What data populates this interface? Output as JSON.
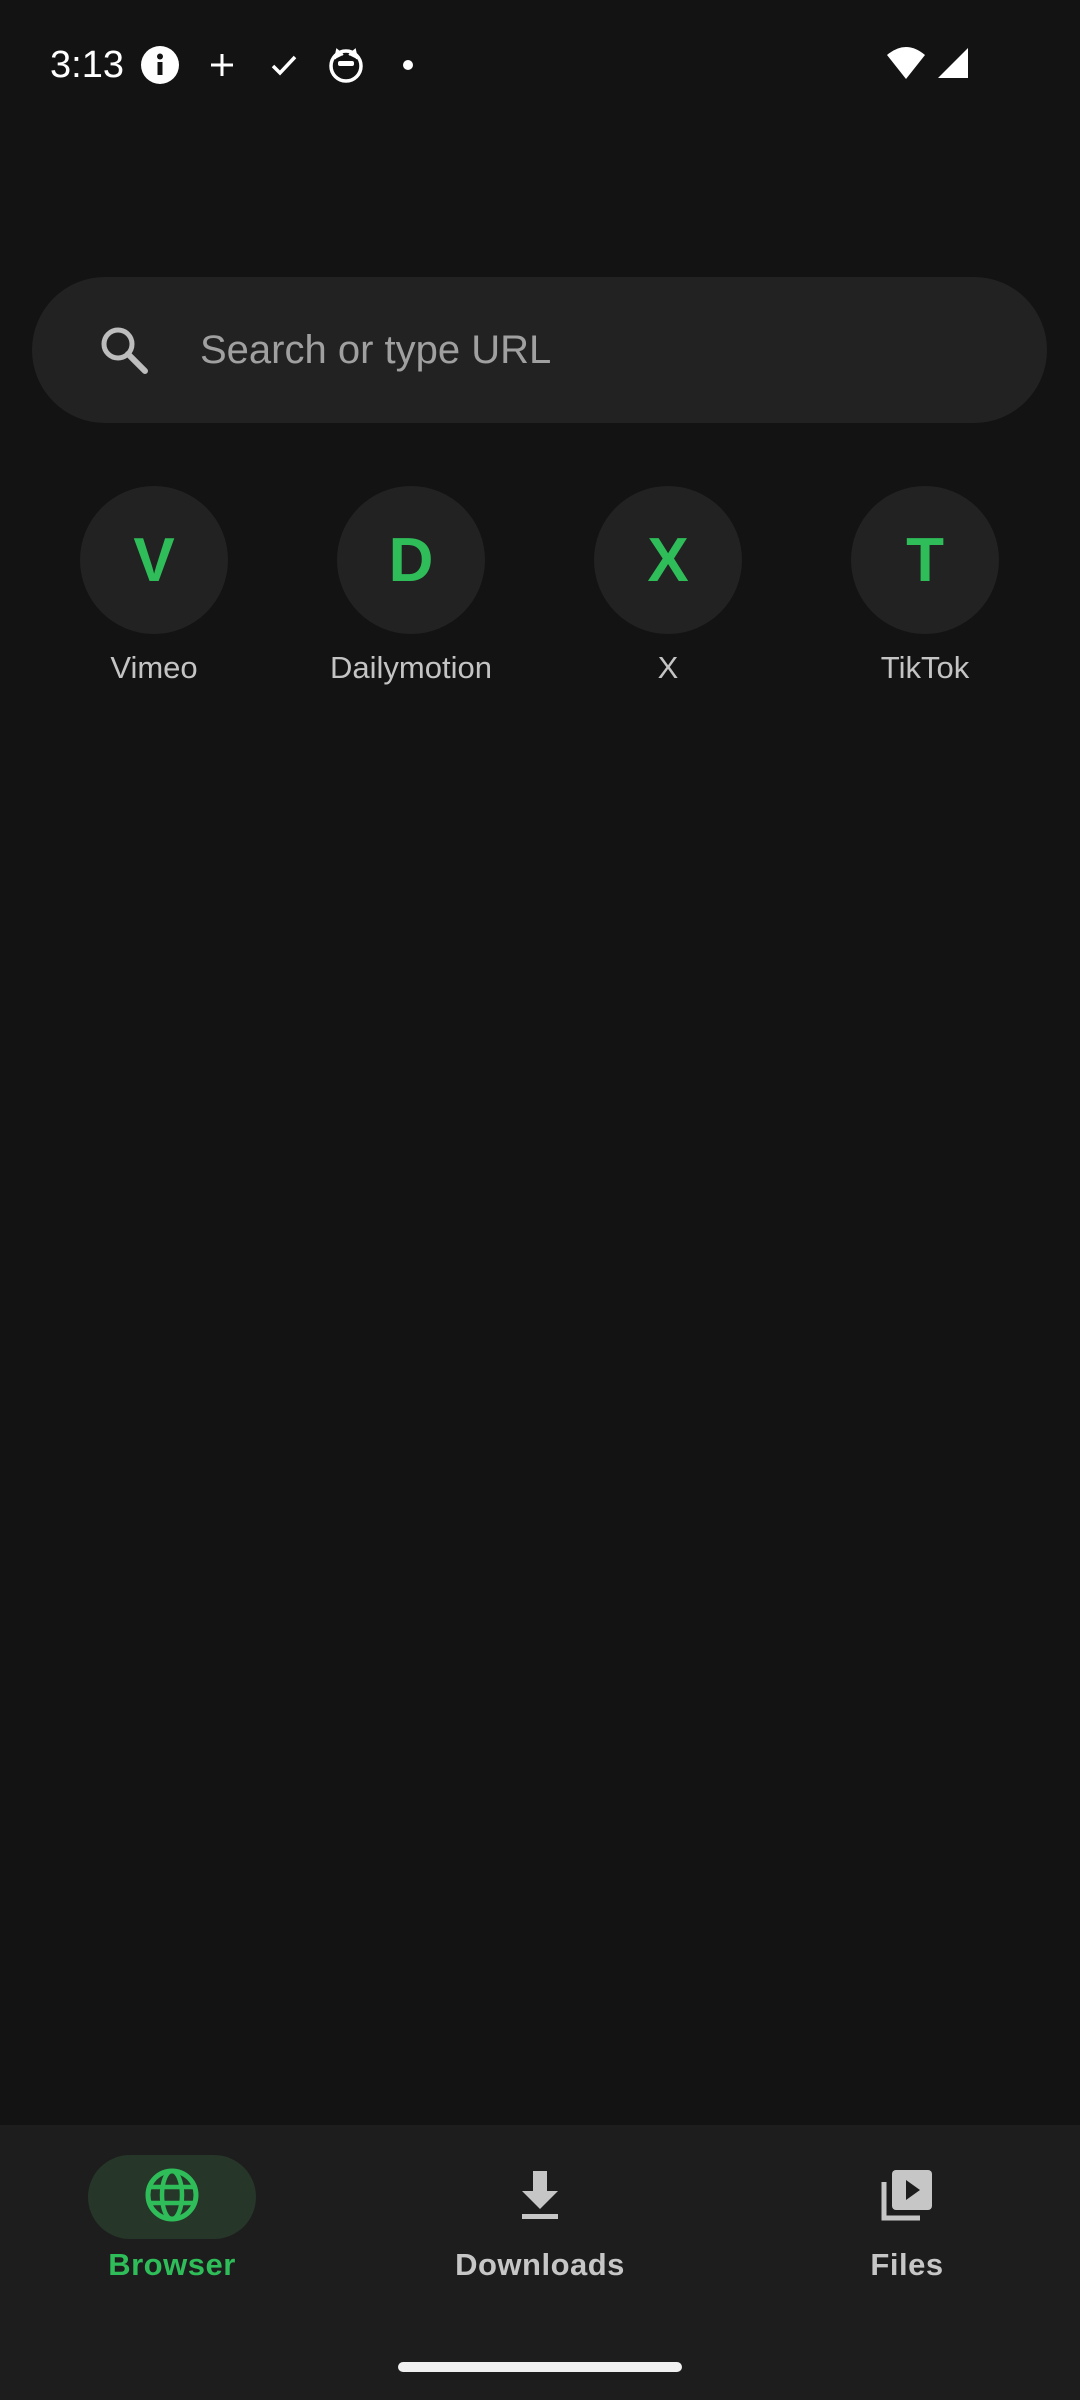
{
  "status_bar": {
    "time": "3:13",
    "icons_left": [
      "info-icon",
      "plus-icon",
      "check-icon",
      "cat-face-icon",
      "dot-icon"
    ],
    "icons_right": [
      "wifi-icon",
      "cell-signal-icon"
    ]
  },
  "search": {
    "placeholder": "Search or type URL",
    "value": ""
  },
  "shortcuts": [
    {
      "letter": "V",
      "label": "Vimeo"
    },
    {
      "letter": "D",
      "label": "Dailymotion"
    },
    {
      "letter": "X",
      "label": "X"
    },
    {
      "letter": "T",
      "label": "TikTok"
    }
  ],
  "bottom_nav": {
    "items": [
      {
        "label": "Browser",
        "icon": "globe-icon",
        "active": true
      },
      {
        "label": "Downloads",
        "icon": "download-icon",
        "active": false
      },
      {
        "label": "Files",
        "icon": "video-library-icon",
        "active": false
      }
    ]
  },
  "colors": {
    "background": "#131313",
    "surface": "#222222",
    "accent": "#2ebd59",
    "nav_background": "#1d1d1d"
  }
}
